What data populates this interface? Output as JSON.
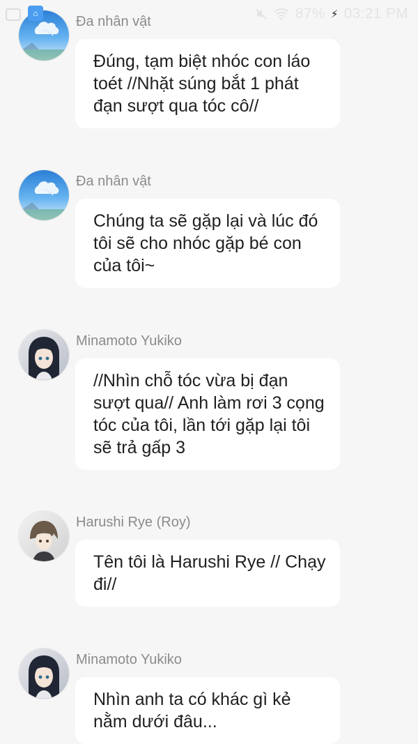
{
  "status_bar": {
    "battery": "87%",
    "time": "03:21 PM",
    "icons": [
      "screen-icon",
      "app-notification-icon",
      "mute-icon",
      "wifi-icon",
      "charging-icon"
    ]
  },
  "messages": [
    {
      "sender": "Đa nhân vật",
      "avatar": "sky-avatar",
      "text": "Đúng, tạm biệt nhóc con láo toét //Nhặt súng bắt 1 phát đạn sượt qua tóc cô//"
    },
    {
      "sender": "Đa nhân vật",
      "avatar": "sky-avatar",
      "text": "Chúng ta sẽ gặp lại và lúc đó tôi sẽ cho nhóc gặp bé con của tôi~"
    },
    {
      "sender": "Minamoto Yukiko",
      "avatar": "anime-girl-avatar",
      "text": "//Nhìn chỗ tóc vừa bị đạn sượt qua// Anh làm rơi 3 cọng tóc của tôi, lần tới gặp lại tôi sẽ trả gấp 3"
    },
    {
      "sender": "Harushi Rye (Roy)",
      "avatar": "anime-boy-avatar",
      "text": "Tên tôi là Harushi Rye // Chạy đi//"
    },
    {
      "sender": "Minamoto Yukiko",
      "avatar": "anime-girl-avatar",
      "text": "Nhìn anh ta có khác gì kẻ nằm dưới đâu..."
    }
  ]
}
